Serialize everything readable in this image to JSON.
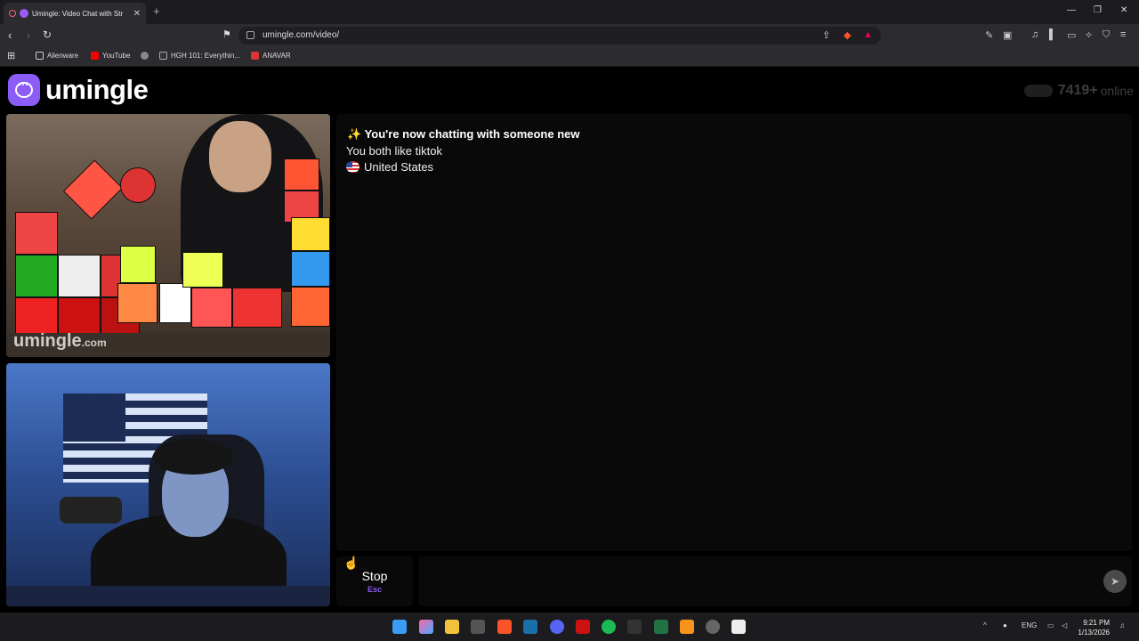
{
  "browser": {
    "tab_title": "Umingle: Video Chat with Str",
    "tab_close": "✕",
    "new_tab": "+",
    "url": "umingle.com/video/",
    "window_controls": [
      "—",
      "❐",
      "✕"
    ],
    "bookmarks": [
      {
        "label": "Alienware",
        "icon": "folder-icon"
      },
      {
        "label": "YouTube",
        "icon": "youtube-icon"
      },
      {
        "label": "HGH 101: Everythin...",
        "icon": "page-icon"
      },
      {
        "label": "ANAVAR",
        "icon": "page-icon"
      }
    ]
  },
  "site": {
    "logo_text": "umingle",
    "online_count": "7419+",
    "online_label": "online",
    "watermark": "umingle",
    "watermark_suffix": ".com"
  },
  "chat": {
    "heading_emoji": "✨",
    "heading": "You're now chatting with someone new",
    "interest": "You both like tiktok",
    "country": "United States"
  },
  "controls": {
    "stop_label": "Stop",
    "stop_hint": "Esc",
    "send_icon": "➤"
  },
  "taskbar": {
    "lang": "ENG",
    "time": "9:21 PM",
    "date": "1/13/2026"
  },
  "colors": {
    "accent": "#8b5cf6",
    "background": "#000000",
    "panel": "#090909"
  }
}
